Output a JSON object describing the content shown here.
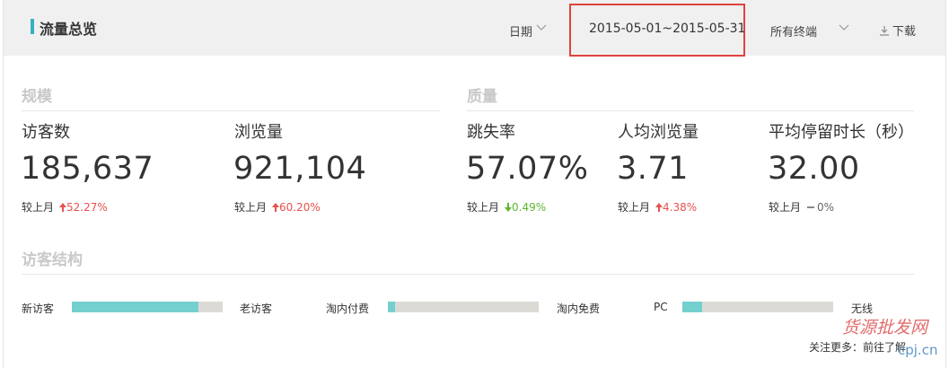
{
  "header": {
    "title": "流量总览",
    "date_label": "日期",
    "date_range": "2015-05-01~2015-05-31",
    "terminal": "所有终端",
    "download": "下载"
  },
  "sections": {
    "scale": "规模",
    "quality": "质量",
    "visitor_structure": "访客结构"
  },
  "compare_label": "较上月",
  "metrics": [
    {
      "label": "访客数",
      "value": "185,637",
      "change": "52.27%",
      "trend": "up"
    },
    {
      "label": "浏览量",
      "value": "921,104",
      "change": "60.20%",
      "trend": "up"
    },
    {
      "label": "跳失率",
      "value": "57.07%",
      "change": "0.49%",
      "trend": "down"
    },
    {
      "label": "人均浏览量",
      "value": "3.71",
      "change": "4.38%",
      "trend": "up"
    },
    {
      "label": "平均停留时长（秒）",
      "value": "32.00",
      "change": "0%",
      "trend": "flat"
    }
  ],
  "structure": [
    {
      "left": "新访客",
      "right": "老访客",
      "left_share": 0.84
    },
    {
      "left": "淘内付费",
      "right": "淘内免费",
      "left_share": 0.05
    },
    {
      "left": "PC",
      "right": "无线",
      "left_share": 0.13
    }
  ],
  "colors": {
    "accent": "#35b2bd",
    "bar_fill": "#74d0cf",
    "bar_track": "#dcdad5",
    "up": "#e5514e",
    "down": "#5fb630",
    "highlight_box": "#e0433d"
  },
  "footer": {
    "note": "关注更多：前往了解",
    "watermark_main": "货源批发网",
    "watermark_sub": "cpj.cn"
  }
}
